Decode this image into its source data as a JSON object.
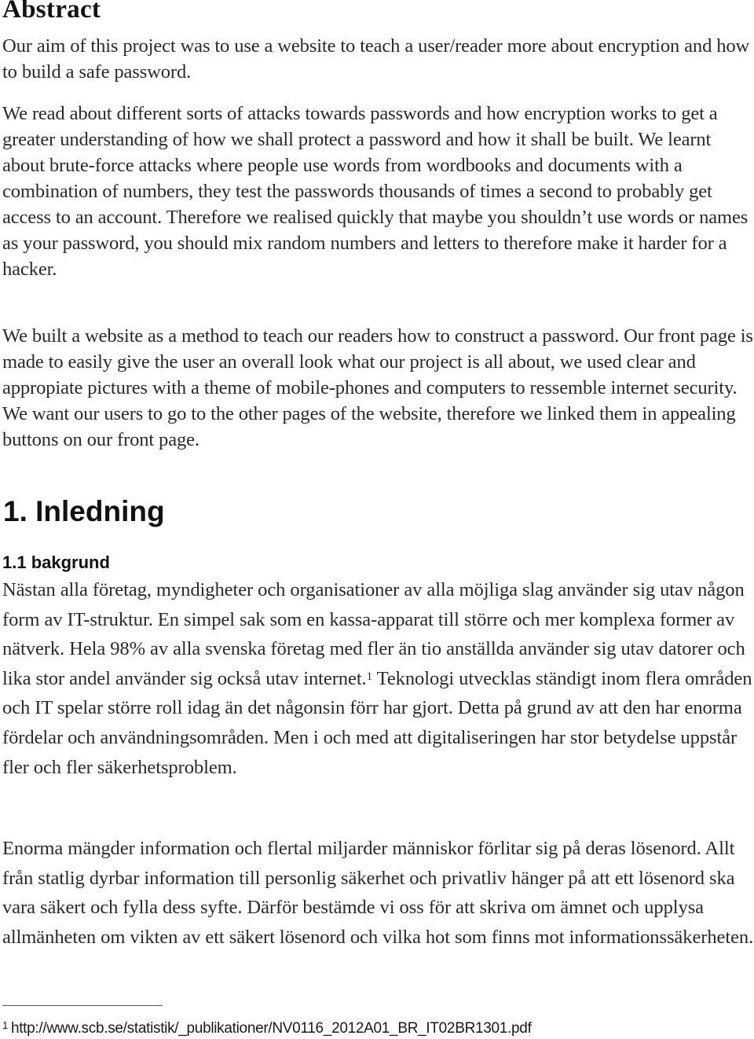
{
  "abstract": {
    "heading": "Abstract",
    "paragraphs": [
      "Our aim of this project was to use a website to teach a user/reader more about encryption and how to build a safe password.",
      "We read about different sorts of attacks towards passwords and how encryption works to get a greater understanding of how we shall protect a password and how it shall be built. We learnt about brute-force attacks where people use words from wordbooks and documents with a combination of numbers, they test the passwords thousands of times a second to probably get access to an account. Therefore we realised quickly that maybe you shouldn’t use words or names as your password, you should mix random numbers and letters to therefore make it harder for a hacker.",
      "We built a website as a method to teach our readers how to construct a password. Our front page is made to easily give the user an overall look what our project is all about, we used clear and appropiate pictures with a theme of mobile-phones and computers to ressemble internet security. We want our users to go to the other pages of the website, therefore we linked them in appealing buttons on our front page."
    ]
  },
  "section1": {
    "heading": "1. Inledning",
    "subsection": {
      "heading": "1.1 bakgrund",
      "paragraph1_part1": "Nästan alla företag, myndigheter och organisationer av alla möjliga slag använder sig utav någon form av IT-struktur. En simpel sak som en kassa-apparat till större och mer komplexa former av nätverk. Hela 98% av alla svenska företag med fler än tio anställda använder sig utav datorer och lika stor andel använder sig också utav internet.",
      "footnote_ref": "1",
      "paragraph1_part2": " Teknologi utvecklas ständigt inom flera områden och IT spelar större roll idag än det någonsin förr har gjort. Detta på grund av att den har enorma fördelar och användningsområden. Men i och med att digitaliseringen har stor betydelse uppstår fler och fler säkerhetsproblem.",
      "paragraph2": "Enorma mängder information och flertal miljarder människor förlitar sig på deras lösenord. Allt från statlig dyrbar information till personlig säkerhet och privatliv hänger på att ett lösenord ska vara säkert och fylla dess syfte. Därför bestämde vi oss för att skriva om ämnet och upplysa allmänheten om vikten av ett säkert lösenord och vilka hot som finns mot informationssäkerheten."
    }
  },
  "footnote": {
    "number": "1",
    "text": "http://www.scb.se/statistik/_publikationer/NV0116_2012A01_BR_IT02BR1301.pdf"
  }
}
